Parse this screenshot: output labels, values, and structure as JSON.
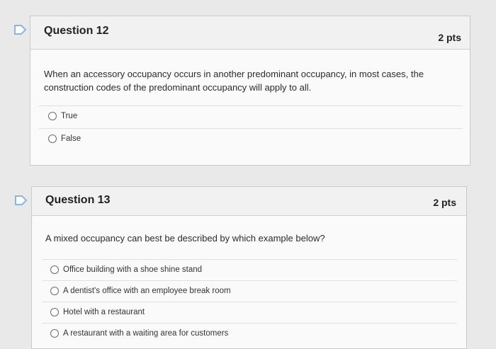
{
  "questions": [
    {
      "title": "Question 12",
      "points": "2 pts",
      "text": "When an accessory occupancy occurs in another predominant occupancy, in most cases, the construction codes of the predominant occupancy will apply to all.",
      "answers": [
        "True",
        "False"
      ]
    },
    {
      "title": "Question 13",
      "points": "2 pts",
      "text": "A mixed occupancy can best be described by which example below?",
      "answers": [
        "Office building with a shoe shine stand",
        "A dentist's office with an employee break room",
        "Hotel with a restaurant",
        "A restaurant with a waiting area for customers"
      ]
    }
  ],
  "colors": {
    "flag": "#8bb6d9",
    "page_bg": "#e9e9e9",
    "card_bg": "#fafafa",
    "header_bg": "#f1f1f1"
  },
  "icons": [
    "bookmark-flag-icon",
    "radio-button-icon"
  ]
}
